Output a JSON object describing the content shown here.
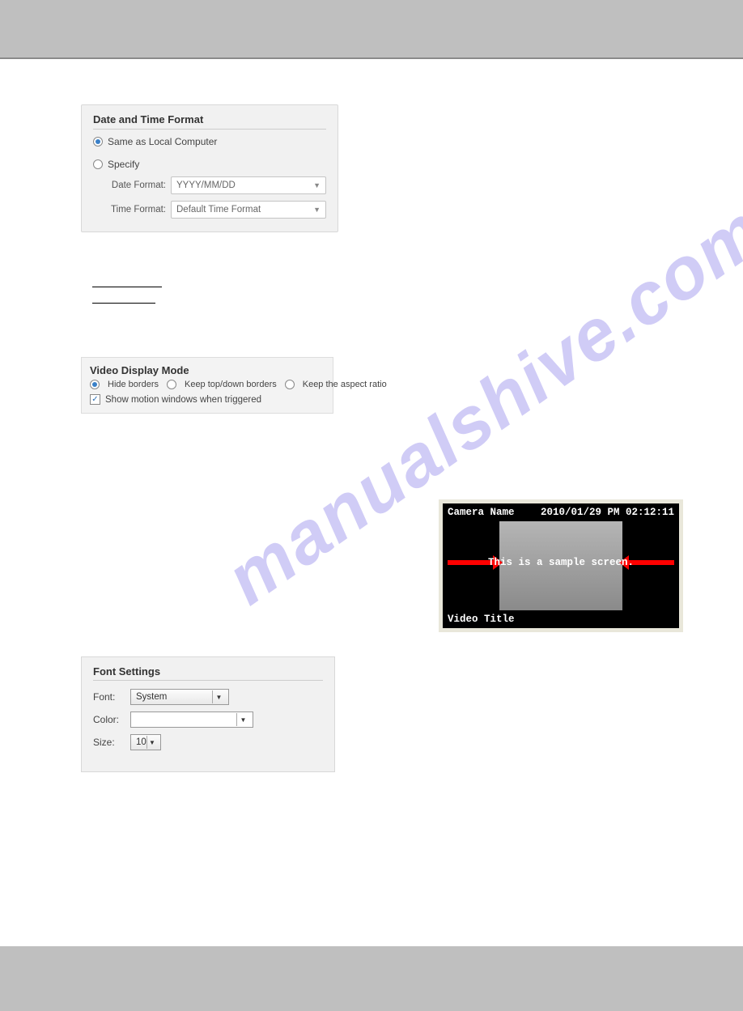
{
  "watermark": "manualshive.com",
  "datetime_panel": {
    "title": "Date and Time Format",
    "option_same": "Same as Local Computer",
    "option_specify": "Specify",
    "date_format_label": "Date Format:",
    "date_format_value": "YYYY/MM/DD",
    "time_format_label": "Time Format:",
    "time_format_value": "Default Time Format"
  },
  "video_display_panel": {
    "title": "Video Display Mode",
    "opt_hide": "Hide borders",
    "opt_keep_td": "Keep top/down borders",
    "opt_aspect": "Keep the aspect ratio",
    "check_motion": "Show motion windows when triggered"
  },
  "sample_screen": {
    "camera_name": "Camera Name",
    "timestamp": "2010/01/29 PM 02:12:11",
    "text": "This is a sample screen.",
    "video_title": "Video Title"
  },
  "font_panel": {
    "title": "Font Settings",
    "font_label": "Font:",
    "font_value": "System",
    "color_label": "Color:",
    "color_value": "",
    "size_label": "Size:",
    "size_value": "10"
  }
}
